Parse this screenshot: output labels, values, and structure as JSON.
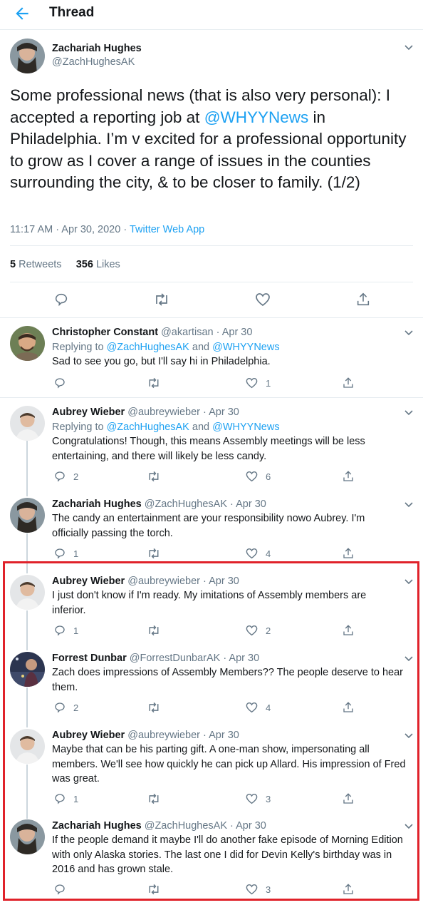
{
  "header": {
    "title": "Thread"
  },
  "main": {
    "name": "Zachariah Hughes",
    "handle": "@ZachHughesAK",
    "text_pre": "Some professional news (that is also very personal): I accepted a reporting job at ",
    "mention": "@WHYYNews",
    "text_post": " in Philadelphia. I’m v excited for a professional opportunity to grow as I cover a range of issues in the counties surrounding the city, & to be closer to family. (1/2)",
    "time": "11:17 AM · Apr 30, 2020 · ",
    "source": "Twitter Web App",
    "retweets_count": "5",
    "retweets_label": "Retweets",
    "likes_count": "356",
    "likes_label": "Likes"
  },
  "replying_label": "Replying to ",
  "replying_and": " and ",
  "replies": [
    {
      "name": "Christopher Constant",
      "handle": "@akartisan",
      "date": " · Apr 30",
      "reply_to_1": "@ZachHughesAK",
      "reply_to_2": "@WHYYNews",
      "text": "Sad to see you go, but I'll say hi in Philadelphia.",
      "replies": "",
      "likes": "1"
    },
    {
      "name": "Aubrey Wieber",
      "handle": "@aubreywieber",
      "date": " · Apr 30",
      "reply_to_1": "@ZachHughesAK",
      "reply_to_2": "@WHYYNews",
      "text": "Congratulations! Though, this means Assembly meetings will be less entertaining, and there will likely be less candy.",
      "replies": "2",
      "likes": "6"
    },
    {
      "name": "Zachariah Hughes",
      "handle": "@ZachHughesAK",
      "date": " · Apr 30",
      "text": "The candy an entertainment are your responsibility nowo Aubrey. I'm officially passing the torch.",
      "replies": "1",
      "likes": "4"
    },
    {
      "name": "Aubrey Wieber",
      "handle": "@aubreywieber",
      "date": " · Apr 30",
      "text": "I just don't know if I'm ready. My imitations of Assembly members are inferior.",
      "replies": "1",
      "likes": "2"
    },
    {
      "name": "Forrest Dunbar",
      "handle": "@ForrestDunbarAK",
      "date": " · Apr 30",
      "text": "Zach does impressions of Assembly Members?? The people deserve to hear them.",
      "replies": "2",
      "likes": "4"
    },
    {
      "name": "Aubrey Wieber",
      "handle": "@aubreywieber",
      "date": " · Apr 30",
      "text": "Maybe that can be his parting gift. A one-man show, impersonating all members. We'll see how quickly he can pick up Allard. His impression of Fred was great.",
      "replies": "1",
      "likes": "3"
    },
    {
      "name": "Zachariah Hughes",
      "handle": "@ZachHughesAK",
      "date": " · Apr 30",
      "text": "If the people demand it maybe I'll do another fake episode of Morning Edition with only Alaska stories. The last one I did for Devin Kelly's birthday was in 2016 and has grown stale.",
      "replies": "",
      "likes": "3"
    }
  ],
  "colors": {
    "accent": "#1da1f2",
    "muted": "#657786",
    "highlight": "#e0222a"
  }
}
